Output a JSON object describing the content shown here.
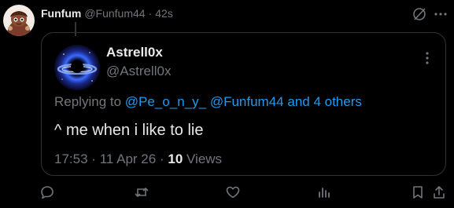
{
  "outer": {
    "display_name": "Funfum",
    "handle": "@Funfum44",
    "separator": "·",
    "time": "42s"
  },
  "quote": {
    "display_name": "Astrell0x",
    "handle": "@Astrell0x",
    "reply_prefix": "Replying to",
    "mentions": [
      "@Pe_o_n_y_",
      "@Funfum44"
    ],
    "reply_suffix": "and 4 others",
    "text": "^ me when i like to lie",
    "timestamp": "17:53",
    "separator": "·",
    "date": "11 Apr 26",
    "views_count": "10",
    "views_label": "Views"
  },
  "icons": {
    "grok": "grok-icon",
    "more": "more-icon",
    "reply": "reply-icon",
    "retweet": "retweet-icon",
    "like": "like-icon",
    "analytics": "analytics-icon",
    "bookmark": "bookmark-icon",
    "share": "share-icon"
  },
  "colors": {
    "background": "#000000",
    "text": "#e7e9ea",
    "secondary": "#71767b",
    "link": "#1d9bf0",
    "border": "#2f3336"
  }
}
